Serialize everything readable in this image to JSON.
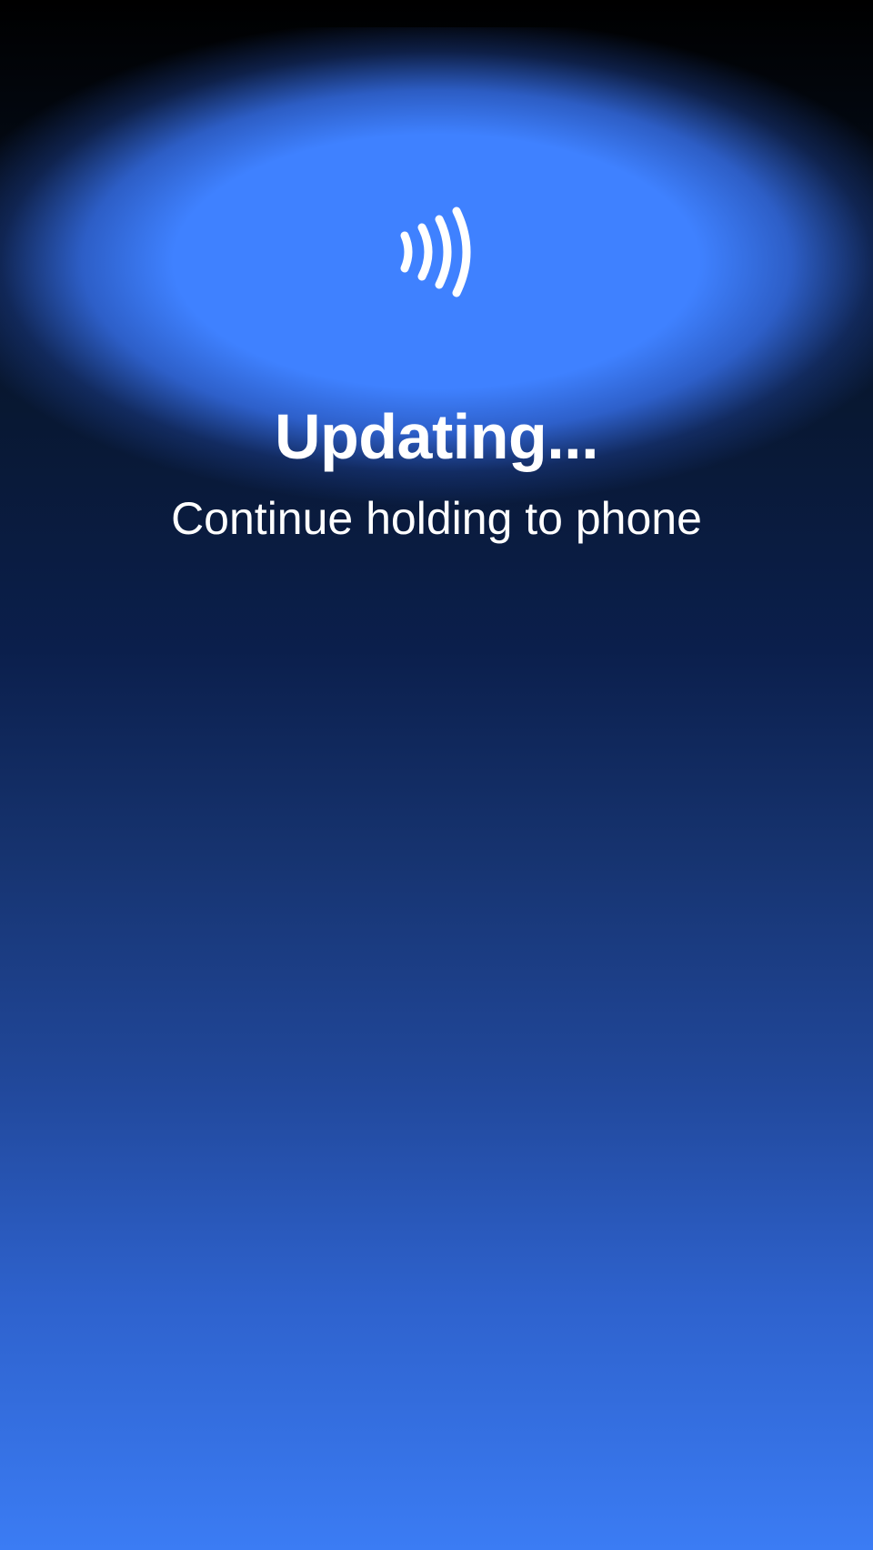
{
  "status": {
    "icon": "contactless-nfc-icon",
    "title": "Updating...",
    "subtitle": "Continue holding to phone"
  },
  "colors": {
    "accent": "#3f81ff",
    "background_top": "#000000",
    "background_bottom": "#3b7cf4",
    "text": "#ffffff"
  }
}
